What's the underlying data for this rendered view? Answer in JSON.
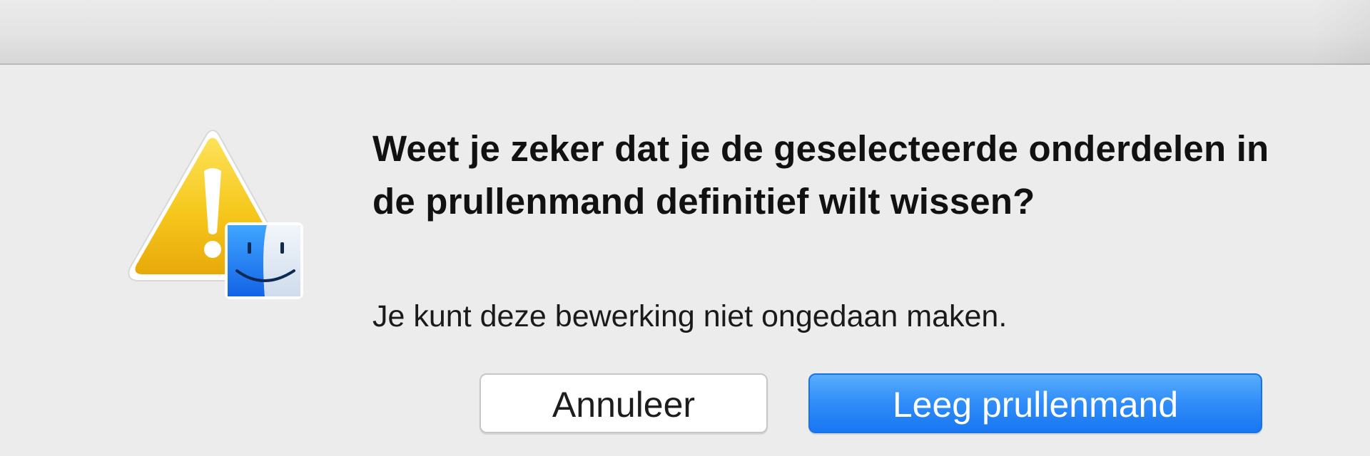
{
  "dialog": {
    "title": "Weet je zeker dat je de geselecteerde onderdelen in de prullenmand definitief wilt wissen?",
    "message": "Je kunt deze bewerking niet ongedaan maken.",
    "icon": "warning-finder-icon",
    "buttons": {
      "cancel_label": "Annuleer",
      "confirm_label": "Leeg prullenmand"
    }
  },
  "colors": {
    "window_background": "#ececec",
    "default_button": "#2f8cf8",
    "warning_yellow": "#f4c20d",
    "finder_blue": "#1f7cf0"
  }
}
